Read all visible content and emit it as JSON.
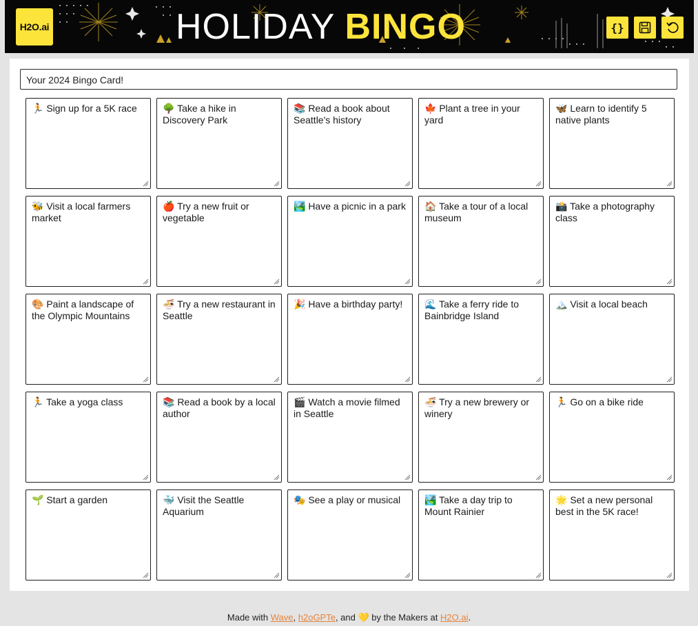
{
  "header": {
    "logo_text": "H2O.ai",
    "title_part1": "HOLIDAY",
    "title_part2": "BINGO",
    "buttons": [
      {
        "name": "code-button",
        "icon": "code-braces-icon",
        "glyph": "{}"
      },
      {
        "name": "save-button",
        "icon": "save-icon",
        "glyph": "💾"
      },
      {
        "name": "reset-button",
        "icon": "reset-icon",
        "glyph": "↺"
      }
    ]
  },
  "card": {
    "title": "Your 2024 Bingo Card!",
    "cells": [
      "🏃 Sign up for a 5K race",
      "🌳 Take a hike in Discovery Park",
      "📚 Read a book about Seattle's history",
      "🍁 Plant a tree in your yard",
      "🦋 Learn to identify 5 native plants",
      "🐝 Visit a local farmers market",
      "🍎 Try a new fruit or vegetable",
      "🏞️ Have a picnic in a park",
      "🏠 Take a tour of a local museum",
      "📸 Take a photography class",
      "🎨 Paint a landscape of the Olympic Mountains",
      "🍜 Try a new restaurant in Seattle",
      "🎉 Have a birthday party!",
      "🌊 Take a ferry ride to Bainbridge Island",
      "🏔️ Visit a local beach",
      "🏃 Take a yoga class",
      "📚 Read a book by a local author",
      "🎬 Watch a movie filmed in Seattle",
      "🍜 Try a new brewery or winery",
      "🏃 Go on a bike ride",
      "🌱 Start a garden",
      "🐳 Visit the Seattle Aquarium",
      "🎭 See a play or musical",
      "🏞️ Take a day trip to Mount Rainier",
      "🌟 Set a new personal best in the 5K race!"
    ]
  },
  "footer": {
    "prefix": "Made with ",
    "link1": "Wave",
    "sep1": ", ",
    "link2": "h2oGPTe",
    "sep2": ", and ",
    "heart": "💛",
    "middle": " by the Makers at ",
    "link3": "H2O.ai",
    "suffix": "."
  },
  "colors": {
    "accent": "#fde43b",
    "header_bg": "#070707",
    "page_bg": "#e4e4e4",
    "link": "#e8833a"
  }
}
